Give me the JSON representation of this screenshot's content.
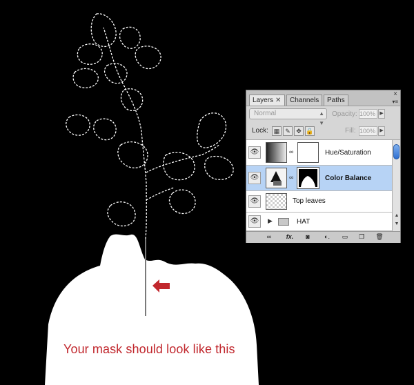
{
  "caption": "Your mask should look like this",
  "colors": {
    "accent_red": "#c1272d",
    "selected_layer": "#b7d3f5"
  },
  "panel": {
    "tabs": [
      {
        "label": "Layers",
        "close": "✕",
        "active": true
      },
      {
        "label": "Channels",
        "active": false
      },
      {
        "label": "Paths",
        "active": false
      }
    ],
    "menu_icon": "▾≡",
    "blend_mode": "Normal",
    "opacity_label": "Opacity:",
    "opacity_value": "100%",
    "lock_label": "Lock:",
    "fill_label": "Fill:",
    "fill_value": "100%",
    "layers": [
      {
        "name": "Hue/Saturation",
        "selected": false,
        "visible": true
      },
      {
        "name": "Color Balance",
        "selected": true,
        "visible": true
      },
      {
        "name": "Top leaves",
        "selected": false,
        "visible": true
      },
      {
        "name": "HAT",
        "selected": false,
        "visible": true,
        "type": "group"
      }
    ],
    "bottom_buttons": [
      "link-icon",
      "fx-icon",
      "mask-icon",
      "adjustment-icon",
      "folder-icon",
      "new-layer-icon",
      "trash-icon"
    ]
  }
}
